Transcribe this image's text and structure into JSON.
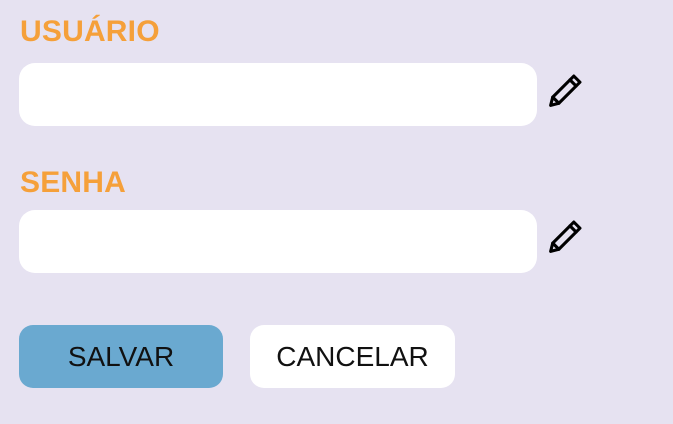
{
  "form": {
    "username": {
      "label": "USUÁRIO",
      "value": "",
      "icon": "pencil-icon"
    },
    "password": {
      "label": "SENHA",
      "value": "",
      "icon": "pencil-icon"
    }
  },
  "actions": {
    "save_label": "SALVAR",
    "cancel_label": "CANCELAR"
  },
  "colors": {
    "background": "#e6e2f1",
    "label": "#f5a03a",
    "save_button": "#6aa9d0",
    "cancel_button": "#ffffff"
  }
}
